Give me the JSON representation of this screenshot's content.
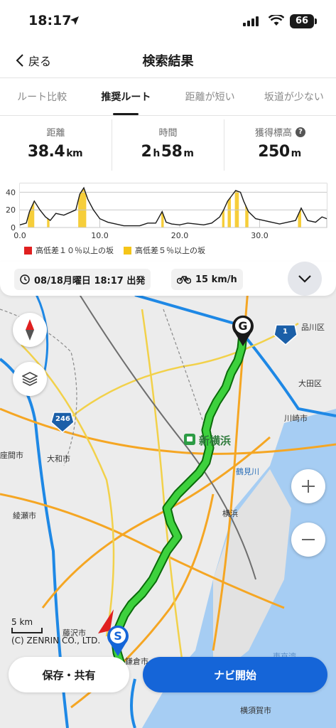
{
  "status": {
    "time": "18:17",
    "battery": "66"
  },
  "header": {
    "back_label": "戻る",
    "title": "検索結果"
  },
  "tabs": [
    {
      "label": "ルート比較",
      "active": false
    },
    {
      "label": "推奨ルート",
      "active": true
    },
    {
      "label": "距離が短い",
      "active": false
    },
    {
      "label": "坂道が少ない",
      "active": false
    }
  ],
  "stats": {
    "distance": {
      "label": "距離",
      "value": "38.4",
      "unit": "km"
    },
    "time": {
      "label": "時間",
      "hours": "2",
      "h": "h",
      "minutes": "58",
      "m": "m"
    },
    "elevation": {
      "label": "獲得標高",
      "value": "250",
      "unit": "m"
    }
  },
  "chart_data": {
    "type": "area",
    "x_ticks": [
      "0.0",
      "10.0",
      "20.0",
      "30.0"
    ],
    "y_ticks": [
      "0",
      "20",
      "40"
    ],
    "xlim": [
      0,
      38.4
    ],
    "ylim": [
      0,
      50
    ],
    "x": [
      0,
      0.8,
      1.2,
      1.8,
      2.5,
      3.2,
      3.8,
      4.5,
      5.5,
      6.5,
      7.0,
      7.5,
      8.0,
      8.5,
      9.2,
      10.0,
      11.0,
      12.0,
      13.0,
      14.0,
      15.0,
      16.0,
      17.0,
      17.8,
      18.3,
      19.0,
      20.0,
      21.0,
      22.0,
      23.0,
      24.0,
      25.0,
      25.5,
      26.0,
      26.5,
      27.0,
      27.6,
      28.0,
      28.6,
      29.5,
      30.5,
      31.5,
      32.5,
      33.5,
      34.5,
      35.2,
      36.0,
      37.0,
      37.8,
      38.4
    ],
    "y": [
      3,
      5,
      18,
      30,
      20,
      12,
      8,
      16,
      14,
      18,
      20,
      38,
      45,
      32,
      20,
      10,
      6,
      4,
      2,
      2,
      2,
      5,
      5,
      18,
      6,
      4,
      3,
      5,
      4,
      3,
      5,
      12,
      20,
      30,
      36,
      42,
      40,
      30,
      18,
      10,
      8,
      6,
      4,
      6,
      8,
      22,
      8,
      6,
      12,
      10
    ],
    "legend": [
      {
        "label": "高低差１０％以上の坂",
        "color": "#e02020"
      },
      {
        "label": "高低差５％以上の坂",
        "color": "#f5c518"
      }
    ],
    "steep5_ranges": [
      [
        1.0,
        1.8
      ],
      [
        3.4,
        3.7
      ],
      [
        7.3,
        8.3
      ],
      [
        17.7,
        18.0
      ],
      [
        25.3,
        25.6
      ],
      [
        26.0,
        26.4
      ],
      [
        26.9,
        27.4
      ],
      [
        28.2,
        28.6
      ],
      [
        34.8,
        35.2
      ]
    ]
  },
  "departure": {
    "date_text": "08/18月曜日 18:17 出発",
    "speed_text": "15 km/h"
  },
  "map": {
    "labels": [
      "品川区",
      "大田区",
      "川崎市",
      "新横浜",
      "鶴見川",
      "横浜",
      "大和市",
      "座間市",
      "綾瀬市",
      "藤沢市",
      "鎌倉市",
      "横須賀市",
      "東京湾",
      "246",
      "1"
    ],
    "start_marker": "S",
    "goal_marker": "G",
    "scale_label": "5 km",
    "copyright": "(C) ZENRIN CO., LTD."
  },
  "buttons": {
    "save": "保存・共有",
    "navigate": "ナビ開始"
  },
  "colors": {
    "accent": "#1565d8",
    "route": "#3dd13d",
    "water": "#a6cdf3"
  }
}
